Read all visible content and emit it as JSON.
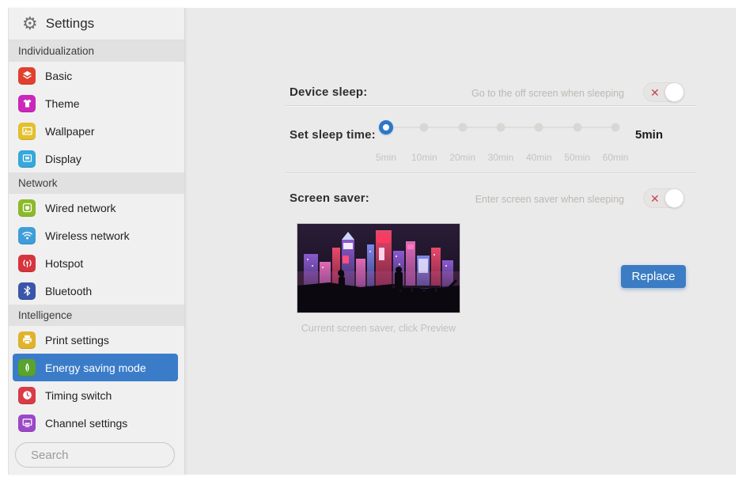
{
  "window": {
    "title": "Settings",
    "title_icon": "gear-icon"
  },
  "sidebar": {
    "sections": [
      {
        "label": "Individualization",
        "items": [
          {
            "label": "Basic",
            "icon": "layers-icon",
            "color": "#e2402e"
          },
          {
            "label": "Theme",
            "icon": "tshirt-icon",
            "color": "#cb28bb"
          },
          {
            "label": "Wallpaper",
            "icon": "photo-icon",
            "color": "#e3c02c"
          },
          {
            "label": "Display",
            "icon": "monitor-icon",
            "color": "#35a8dc"
          }
        ]
      },
      {
        "label": "Network",
        "items": [
          {
            "label": "Wired network",
            "icon": "wired-network-icon",
            "color": "#8cba2a"
          },
          {
            "label": "Wireless network",
            "icon": "wifi-icon",
            "color": "#3f9eda"
          },
          {
            "label": "Hotspot",
            "icon": "hotspot-icon",
            "color": "#d6343e"
          },
          {
            "label": "Bluetooth",
            "icon": "bluetooth-icon",
            "color": "#3a56ab"
          }
        ]
      },
      {
        "label": "Intelligence",
        "items": [
          {
            "label": "Print settings",
            "icon": "printer-icon",
            "color": "#e0b32b"
          },
          {
            "label": "Energy saving mode",
            "icon": "leaf-icon",
            "color": "#5aa32c",
            "selected": true
          },
          {
            "label": "Timing switch",
            "icon": "clock-icon",
            "color": "#d93c46"
          },
          {
            "label": "Channel settings",
            "icon": "channel-monitor-icon",
            "color": "#9b48c9"
          }
        ]
      }
    ],
    "search": {
      "placeholder": "Search",
      "icon": "search-icon"
    }
  },
  "main": {
    "device_sleep": {
      "label": "Device sleep:",
      "description": "Go to the off screen when sleeping",
      "toggle_state": "off"
    },
    "sleep_time": {
      "label": "Set sleep time:",
      "value": "5min",
      "options": [
        "5min",
        "10min",
        "20min",
        "30min",
        "40min",
        "50min",
        "60min"
      ],
      "selected_index": 0
    },
    "screen_saver": {
      "label": "Screen saver:",
      "description": "Enter screen saver when sleeping",
      "toggle_state": "off",
      "caption": "Current screen saver, click Preview",
      "replace_label": "Replace"
    }
  },
  "colors": {
    "accent_blue": "#3b7cc9",
    "button_blue": "#3b7cc4",
    "toggle_off_red": "#c4454e",
    "slider_active_blue": "#2d77c8"
  }
}
